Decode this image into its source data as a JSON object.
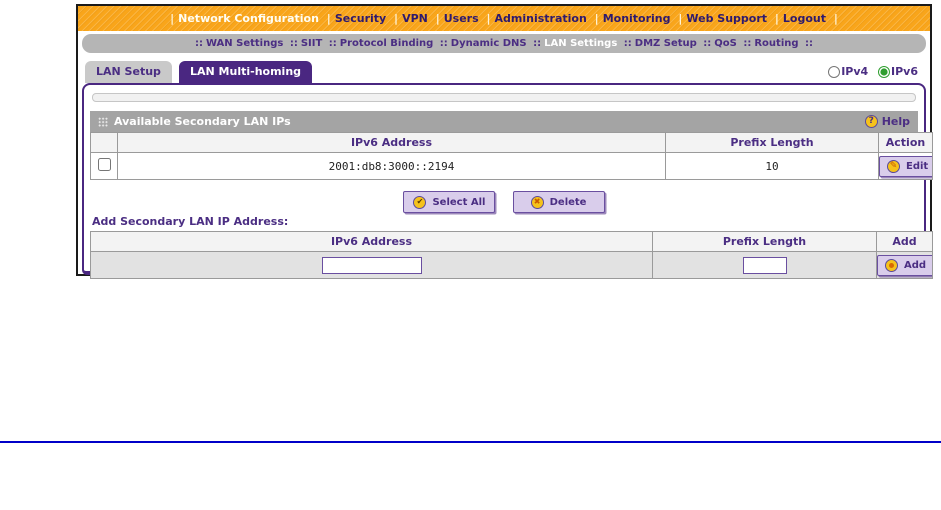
{
  "nav": {
    "separator": "|",
    "items": [
      {
        "label": "Network Configuration",
        "active": true
      },
      {
        "label": "Security",
        "active": false
      },
      {
        "label": "VPN",
        "active": false
      },
      {
        "label": "Users",
        "active": false
      },
      {
        "label": "Administration",
        "active": false
      },
      {
        "label": "Monitoring",
        "active": false
      },
      {
        "label": "Web Support",
        "active": false
      },
      {
        "label": "Logout",
        "active": false
      }
    ]
  },
  "subnav": {
    "separator": "::",
    "items": [
      {
        "label": "WAN Settings",
        "active": false
      },
      {
        "label": "SIIT",
        "active": false
      },
      {
        "label": "Protocol Binding",
        "active": false
      },
      {
        "label": "Dynamic DNS",
        "active": false
      },
      {
        "label": "LAN Settings",
        "active": true
      },
      {
        "label": "DMZ Setup",
        "active": false
      },
      {
        "label": "QoS",
        "active": false
      },
      {
        "label": "Routing",
        "active": false
      }
    ]
  },
  "tabs": [
    {
      "label": "LAN Setup",
      "active": false
    },
    {
      "label": "LAN Multi-homing",
      "active": true
    }
  ],
  "ip_version": {
    "ipv4_label": "IPv4",
    "ipv6_label": "IPv6",
    "selected": "IPv6"
  },
  "section": {
    "title": "Available Secondary LAN IPs",
    "help_label": "Help"
  },
  "available_table": {
    "headers": {
      "ipv6": "IPv6 Address",
      "prefix": "Prefix Length",
      "action": "Action"
    },
    "rows": [
      {
        "ipv6": "2001:db8:3000::2194",
        "prefix": "10",
        "checked": false,
        "edit_label": "Edit"
      }
    ]
  },
  "actions": {
    "select_all_label": "Select All",
    "delete_label": "Delete"
  },
  "add_section": {
    "title": "Add Secondary LAN IP Address:",
    "headers": {
      "ipv6": "IPv6 Address",
      "prefix": "Prefix Length",
      "add": "Add"
    },
    "ipv6_value": "",
    "prefix_value": "",
    "add_label": "Add"
  },
  "colors": {
    "accent_orange": "#F9A51A",
    "brand_purple": "#4B2E83",
    "active_tab": "#4A2781",
    "blue_rule": "#0000C8",
    "gold_icon": "#F5C21B"
  }
}
